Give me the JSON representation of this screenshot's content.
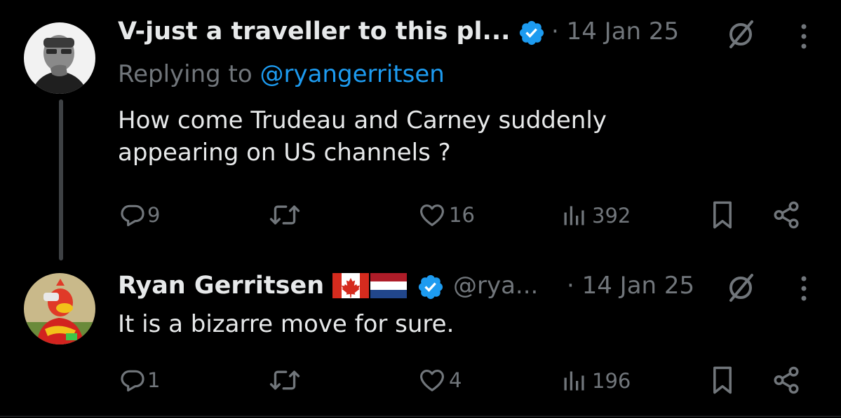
{
  "tweets": [
    {
      "author_name": "V-just a traveller to this pl...",
      "handle": "",
      "date": "· 14 Jan 25",
      "replying_prefix": "Replying to ",
      "replying_handle": "@ryangerritsen",
      "text_line1": "How come Trudeau and Carney suddenly",
      "text_line2": "appearing on US channels ?",
      "replies": "9",
      "retweets": "",
      "likes": "16",
      "views": "392"
    },
    {
      "author_name": "Ryan Gerritsen",
      "handle": "@rya...",
      "date": "· 14 Jan 25",
      "text_line1": "It is a bizarre move for sure.",
      "replies": "1",
      "retweets": "",
      "likes": "4",
      "views": "196"
    }
  ],
  "icons": {
    "verified": "verified-badge-icon",
    "grok": "grok-icon",
    "more": "more-icon",
    "reply": "reply-icon",
    "retweet": "retweet-icon",
    "like": "heart-icon",
    "views": "views-icon",
    "bookmark": "bookmark-icon",
    "share": "share-icon"
  },
  "colors": {
    "background": "#000000",
    "text": "#e7e9ea",
    "secondary": "#71767b",
    "accent": "#1d9bf0"
  }
}
